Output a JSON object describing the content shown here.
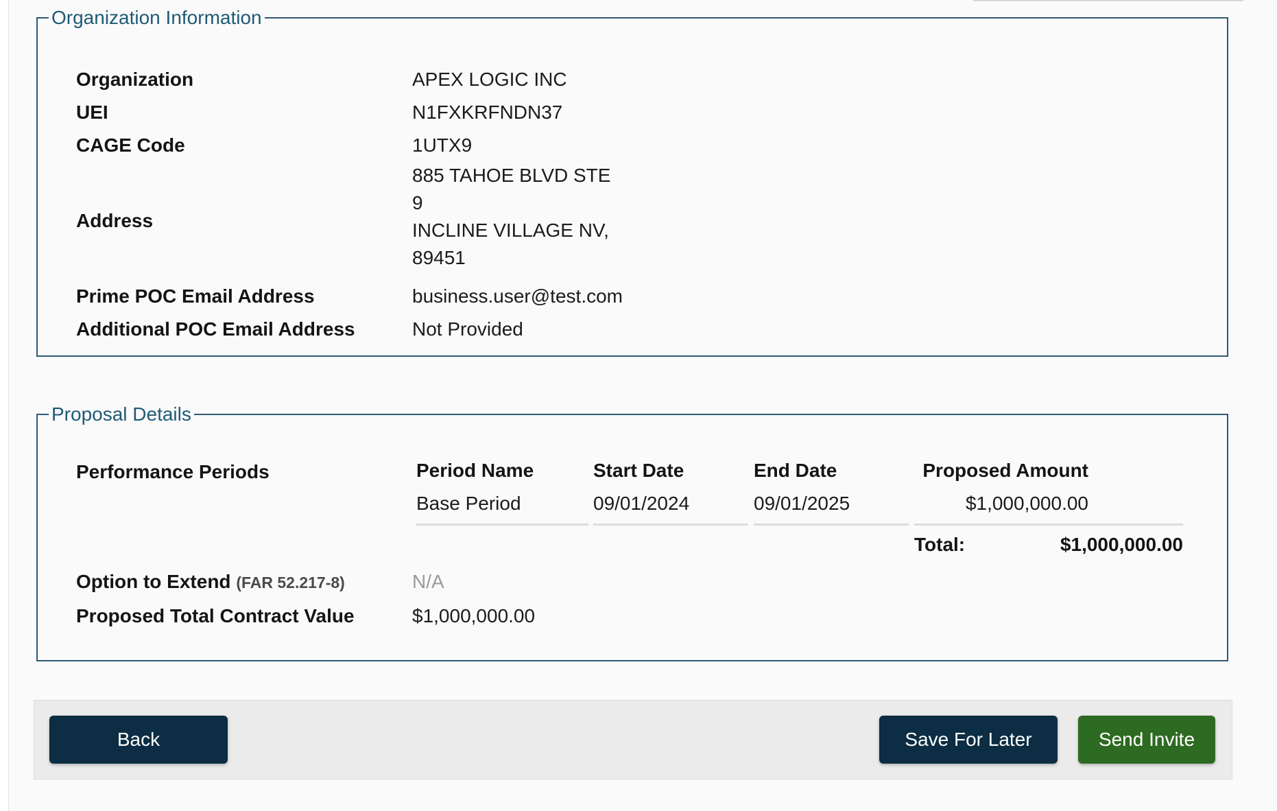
{
  "organization_info": {
    "legend": "Organization Information",
    "organization_label": "Organization",
    "organization_value": "APEX LOGIC INC",
    "uei_label": "UEI",
    "uei_value": "N1FXKRFNDN37",
    "cage_label": "CAGE Code",
    "cage_value": "1UTX9",
    "address_label": "Address",
    "address_lines": [
      "885 TAHOE BLVD STE",
      "9",
      "INCLINE VILLAGE NV,",
      "89451"
    ],
    "prime_poc_label": "Prime POC Email Address",
    "prime_poc_value": "business.user@test.com",
    "additional_poc_label": "Additional POC Email Address",
    "additional_poc_value": "Not Provided"
  },
  "proposal_details": {
    "legend": "Proposal Details",
    "performance_periods_label": "Performance Periods",
    "table": {
      "headers": {
        "period_name": "Period Name",
        "start_date": "Start Date",
        "end_date": "End Date",
        "proposed_amount": "Proposed Amount"
      },
      "rows": [
        {
          "period_name": "Base Period",
          "start_date": "09/01/2024",
          "end_date": "09/01/2025",
          "proposed_amount": "$1,000,000.00"
        }
      ],
      "total_label": "Total:",
      "total_value": "$1,000,000.00"
    },
    "option_to_extend_label": "Option to Extend",
    "option_to_extend_note": "(FAR 52.217-8)",
    "option_to_extend_value": "N/A",
    "total_contract_label": "Proposed Total Contract Value",
    "total_contract_value": "$1,000,000.00"
  },
  "actions": {
    "back_label": "Back",
    "save_label": "Save For Later",
    "send_label": "Send Invite"
  },
  "colors": {
    "primary_button": "#0c2d43",
    "success_button": "#2e6b22",
    "legend_text": "#205a75",
    "fieldset_border": "#2d5a73"
  }
}
